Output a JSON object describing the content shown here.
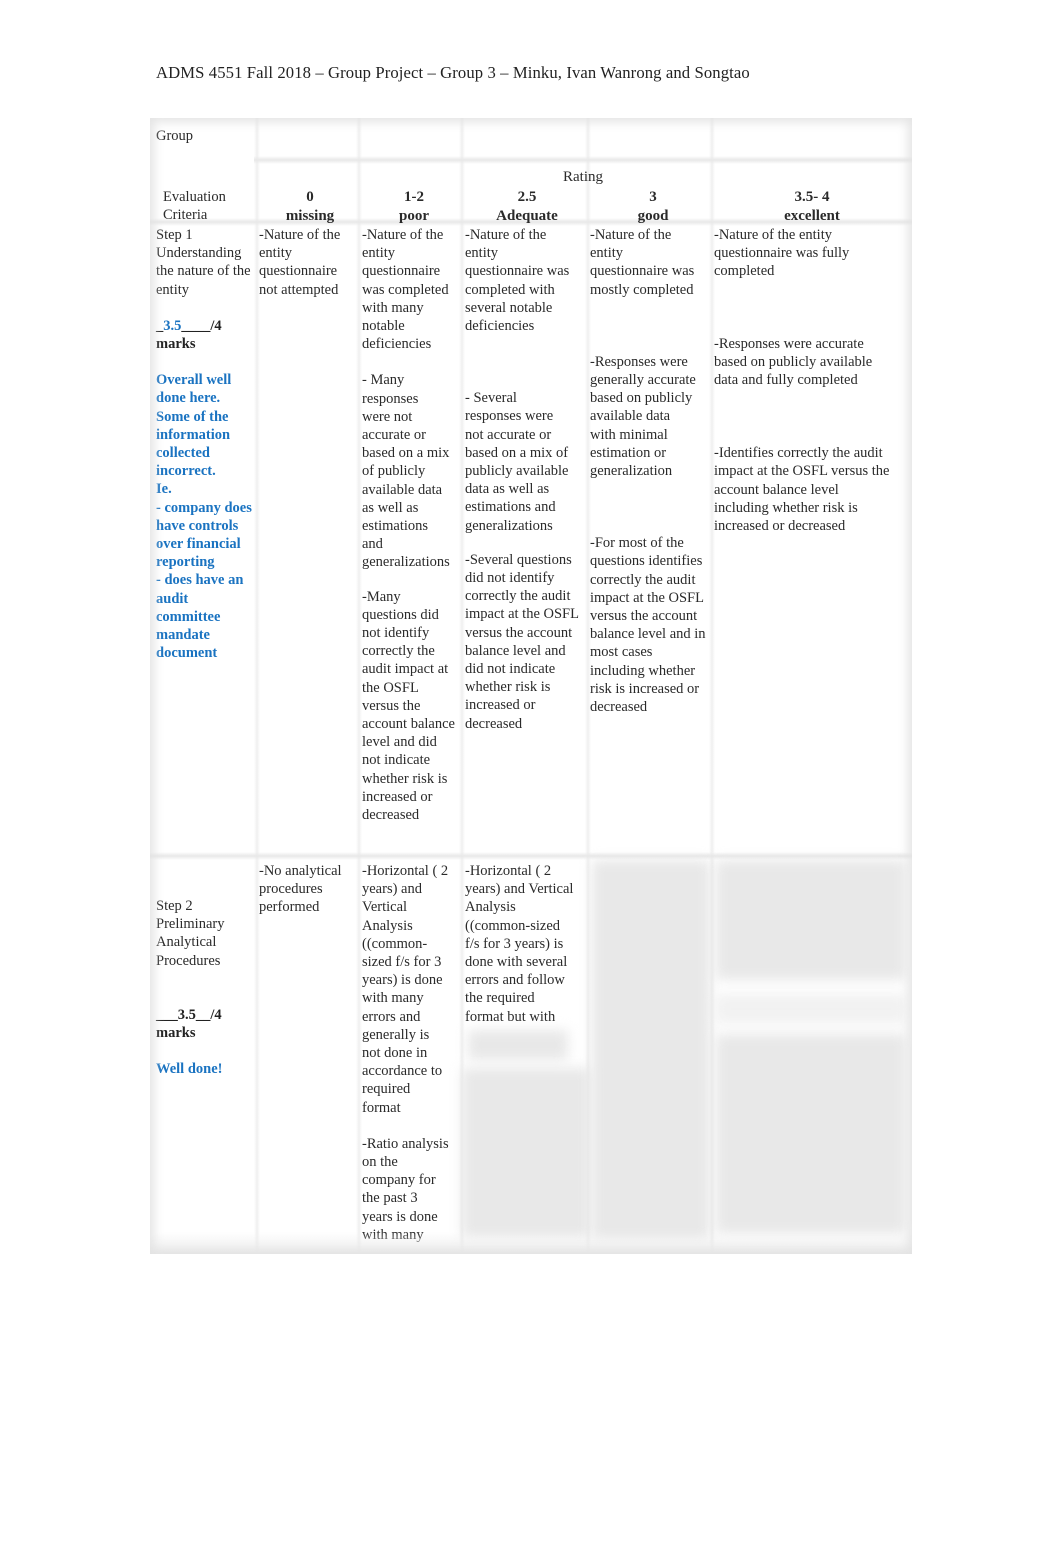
{
  "document": {
    "title": "ADMS 4551 Fall 2018 – Group Project – Group 3 – Minku, Ivan Wanrong and Songtao"
  },
  "rubric": {
    "group_label": "Group",
    "rating_label": "Rating",
    "criteria_header": "Evaluation\nCriteria",
    "columns": [
      {
        "score": "0",
        "label": "missing"
      },
      {
        "score": "1-2",
        "label": "poor"
      },
      {
        "score": "2.5",
        "label": "Adequate"
      },
      {
        "score": "3",
        "label": "good"
      },
      {
        "score": "3.5- 4",
        "label": "excellent"
      }
    ],
    "rows": [
      {
        "criterion": "Step 1\nUnderstanding\nthe nature of the\nentity",
        "mark_prefix": "_",
        "mark_value": "3.5",
        "mark_suffix": "____/4",
        "mark_unit": "marks",
        "feedback": "Overall well\ndone here.\nSome of the\ninformation\ncollected\nincorrect.\nIe.\n- company does\nhave controls\nover financial\nreporting\n- does have an\naudit\ncommittee\nmandate\ndocument",
        "cells": [
          [
            "-Nature of the\nentity\nquestionnaire\nnot attempted"
          ],
          [
            "-Nature of the\nentity\nquestionnaire\nwas completed\nwith many\nnotable\ndeficiencies",
            "- Many\nresponses\nwere not\naccurate or\nbased on a mix\nof publicly\navailable data\nas well as\nestimations\nand\ngeneralizations",
            "-Many\nquestions  did\nnot identify\ncorrectly  the\naudit impact at\nthe  OSFL\nversus the\naccount balance\nlevel and did\nnot indicate\nwhether risk is\nincreased or\ndecreased"
          ],
          [
            "-Nature of the\nentity\nquestionnaire was\ncompleted with\nseveral notable\ndeficiencies",
            "- Several\nresponses were\nnot accurate or\nbased on a mix of\npublicly available\ndata  as well as\nestimations and\ngeneralizations",
            "-Several  questions\ndid not identify\ncorrectly  the audit\nimpact at the  OSFL\nversus the account\nbalance level and\ndid not indicate\nwhether risk is\nincreased or\ndecreased"
          ],
          [
            "-Nature of the\nentity\nquestionnaire was\nmostly completed",
            "-Responses were\ngenerally accurate\nbased on publicly\navailable data\nwith minimal\nestimation or\ngeneralization",
            "-For most of the\nquestions identifies\ncorrectly  the audit\nimpact at the  OSFL\nversus the account\nbalance level and in\nmost cases\nincluding whether\nrisk is increased or\ndecreased"
          ],
          [
            "-Nature of the entity\nquestionnaire was fully\ncompleted",
            "-Responses were accurate\nbased on publicly available\ndata and fully completed",
            "-Identifies correctly   the audit\nimpact at the  OSFL versus the\naccount balance level\nincluding whether risk is\nincreased or decreased"
          ]
        ]
      },
      {
        "criterion": "Step 2\nPreliminary\nAnalytical\nProcedures",
        "mark_prefix": "___",
        "mark_value": "3.5",
        "mark_suffix": "__/4",
        "mark_unit": "marks",
        "feedback": "Well done!",
        "cells": [
          [
            "-No analytical\nprocedures\nperformed"
          ],
          [
            "-Horizontal ( 2\nyears) and\nVertical\nAnalysis\n((common-\nsized f/s for 3\nyears) is   done\nwith  many\nerrors and\ngenerally is\nnot done in\naccordance to\nrequired\nformat",
            "-Ratio analysis\non the\ncompany for\nthe past 3\nyears  is done\nwith many"
          ],
          [
            "-Horizontal ( 2\nyears) and Vertical\nAnalysis\n((common-sized\nf/s for 3 years) is\ndone with several\nerrors  and  follow\nthe  required\nformat  but with"
          ]
        ]
      }
    ]
  }
}
